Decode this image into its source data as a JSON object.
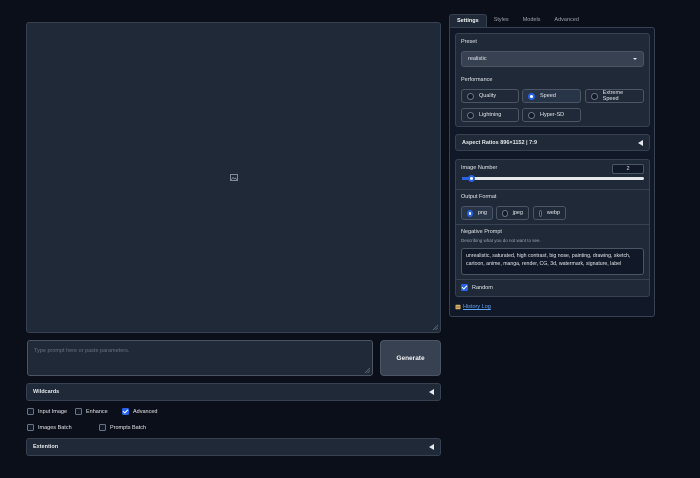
{
  "left": {
    "prompt_placeholder": "Type prompt here or paste parameters.",
    "generate_label": "Generate",
    "wildcards_label": "Wildcards",
    "extention_label": "Extention",
    "checkboxes": [
      {
        "label": "Input Image",
        "checked": false
      },
      {
        "label": "Enhance",
        "checked": false
      },
      {
        "label": "Advanced",
        "checked": true
      },
      {
        "label": "Images Batch",
        "checked": false
      },
      {
        "label": "Prompts Batch",
        "checked": false
      }
    ]
  },
  "tabs": [
    "Settings",
    "Styles",
    "Models",
    "Advanced"
  ],
  "active_tab": "Settings",
  "settings": {
    "preset_label": "Preset",
    "preset_value": "realistic",
    "performance_label": "Performance",
    "performance_options": [
      {
        "label": "Quality",
        "selected": false
      },
      {
        "label": "Speed",
        "selected": true
      },
      {
        "label": "Extreme Speed",
        "selected": false
      },
      {
        "label": "Lightning",
        "selected": false
      },
      {
        "label": "Hyper-SD",
        "selected": false
      }
    ],
    "aspect_ratios_label": "Aspect Ratios 896×1152 | 7:9",
    "image_number_label": "Image Number",
    "image_number_value": "2",
    "image_number_fraction": 0.05,
    "output_format_label": "Output Format",
    "output_formats": [
      {
        "label": "png",
        "selected": true
      },
      {
        "label": "jpeg",
        "selected": false
      },
      {
        "label": "webp",
        "selected": false
      }
    ],
    "negative_prompt_label": "Negative Prompt",
    "negative_prompt_sub": "Describing what you do not want to see.",
    "negative_prompt_value": "unrealistic, saturated, high contrast, big nose, painting, drawing, sketch, cartoon, anime, manga, render, CG, 3d, watermark, signature, label",
    "random_label": "Random",
    "random_checked": true,
    "history_log_label": "History Log"
  },
  "colors": {
    "accent": "#2563eb",
    "background": "#0b0f19",
    "panel": "#1f2937",
    "border": "#374151",
    "link": "#60a5fa"
  }
}
